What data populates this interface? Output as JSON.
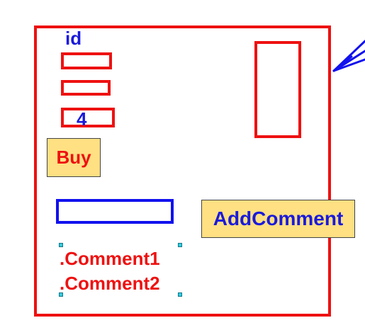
{
  "mockup": {
    "id_label": "id",
    "quantity_value": "4",
    "buy_button_label": "Buy",
    "add_comment_button_label": "AddComment",
    "comments": [
      ".Comment1",
      ".Comment2"
    ]
  },
  "colors": {
    "frame_red": "#ee1111",
    "input_blue": "#1111ee",
    "text_blue": "#1a1adb",
    "button_fill": "#ffe082",
    "selection_handle": "#33ccdd"
  },
  "icons": {
    "pointer": "arrow-pointer-icon"
  }
}
